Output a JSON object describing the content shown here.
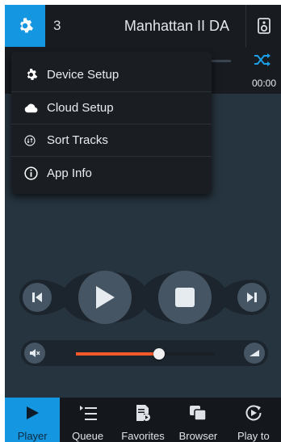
{
  "header": {
    "queue_count": "3",
    "device_name": "Manhattan II DA"
  },
  "player": {
    "time": "00:00",
    "volume_fraction": 0.6
  },
  "menu": {
    "items": [
      {
        "label": "Device Setup",
        "icon": "gear-icon"
      },
      {
        "label": "Cloud Setup",
        "icon": "cloud-icon"
      },
      {
        "label": "Sort Tracks",
        "icon": "sort-icon"
      },
      {
        "label": "App Info",
        "icon": "info-icon"
      }
    ]
  },
  "nav": {
    "tabs": [
      {
        "label": "Player",
        "icon": "play-icon",
        "active": true
      },
      {
        "label": "Queue",
        "icon": "queue-icon"
      },
      {
        "label": "Favorites",
        "icon": "favorites-icon"
      },
      {
        "label": "Browser",
        "icon": "browser-icon"
      },
      {
        "label": "Play to",
        "icon": "play-to-icon"
      }
    ]
  },
  "colors": {
    "accent": "#1596e0",
    "background": "#26343f",
    "volume_fill": "#f2592b"
  }
}
